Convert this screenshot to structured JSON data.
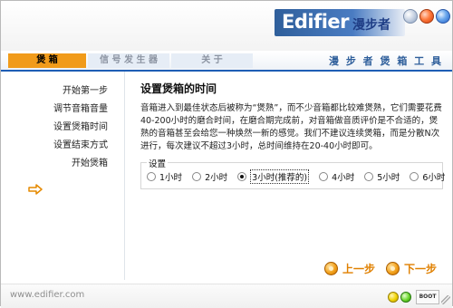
{
  "header": {
    "brand": "Edifier",
    "brand_cn": "漫步者"
  },
  "tabs": [
    {
      "label": "煲 箱"
    },
    {
      "label": "信 号 发 生 器"
    },
    {
      "label": "关 于"
    }
  ],
  "tools_title": "漫 步 者 煲 箱 工 具",
  "sidebar": {
    "items": [
      {
        "label": "开始第一步"
      },
      {
        "label": "调节音箱音量"
      },
      {
        "label": "设置煲箱时间"
      },
      {
        "label": "设置结束方式"
      },
      {
        "label": "开始煲箱"
      }
    ],
    "active_index": 2
  },
  "main": {
    "title": "设置煲箱的时间",
    "paragraph": "音箱进入到最佳状态后被称为“煲熟”，而不少音箱都比较难煲熟，它们需要花费40-200小时的磨合时间，在磨合期完成前，对音箱做音质评价是不合适的，煲熟的音箱甚至会给您一种焕然一新的感觉。我们不建议连续煲箱，而是分散N次进行，每次建议不超过3小时，总时间维持在20-40小时即可。",
    "settings_label": "设置",
    "options": [
      {
        "label": "1小时",
        "checked": false
      },
      {
        "label": "2小时",
        "checked": false
      },
      {
        "label": "3小时(推荐的)",
        "checked": true
      },
      {
        "label": "4小时",
        "checked": false
      },
      {
        "label": "5小时",
        "checked": false
      },
      {
        "label": "6小时",
        "checked": false
      }
    ]
  },
  "buttons": {
    "prev": "上一步",
    "next": "下一步"
  },
  "footer": {
    "url": "www.edifier.com",
    "badge": "BOOT"
  },
  "colors": {
    "accent_blue": "#1e5db5",
    "tab_orange": "#f19b1a",
    "button_orange": "#e08000"
  }
}
